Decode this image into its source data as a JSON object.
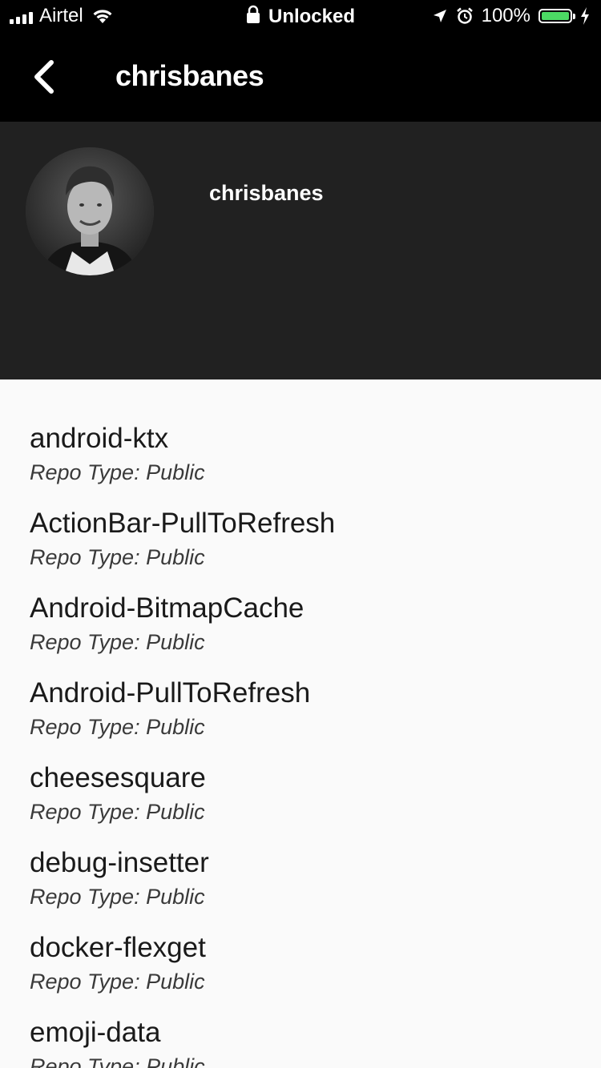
{
  "status_bar": {
    "carrier": "Airtel",
    "lock_text": "Unlocked",
    "battery": "100%",
    "battery_level": 1.0,
    "battery_color": "#4cd964",
    "icons": [
      "signal-icon",
      "wifi-icon",
      "lock-icon",
      "location-icon",
      "alarm-icon",
      "battery-icon",
      "charging-icon"
    ]
  },
  "navbar": {
    "title": "chrisbanes",
    "back_icon": "chevron-left-icon"
  },
  "profile": {
    "username": "chrisbanes",
    "background": "#212121"
  },
  "repos": [
    {
      "name": "android-ktx",
      "type": "Repo Type: Public"
    },
    {
      "name": "ActionBar-PullToRefresh",
      "type": "Repo Type: Public"
    },
    {
      "name": "Android-BitmapCache",
      "type": "Repo Type: Public"
    },
    {
      "name": "Android-PullToRefresh",
      "type": "Repo Type: Public"
    },
    {
      "name": "cheesesquare",
      "type": "Repo Type: Public"
    },
    {
      "name": "debug-insetter",
      "type": "Repo Type: Public"
    },
    {
      "name": "docker-flexget",
      "type": "Repo Type: Public"
    },
    {
      "name": "emoji-data",
      "type": "Repo Type: Public"
    }
  ]
}
